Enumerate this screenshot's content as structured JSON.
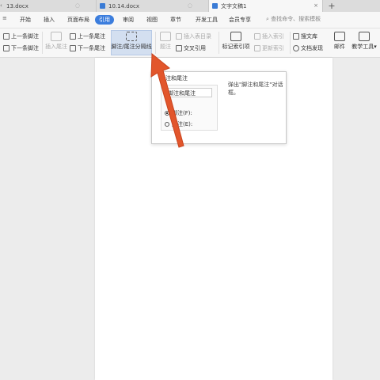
{
  "tabs": [
    {
      "label": "13.docx"
    },
    {
      "label": "10.14.docx"
    },
    {
      "label": "文字文稿1"
    }
  ],
  "menu": {
    "items": [
      "开始",
      "插入",
      "页面布局",
      "引用",
      "审阅",
      "视图",
      "章节",
      "开发工具",
      "会员专享"
    ],
    "active": "引用",
    "search_placeholder": "查找命令、搜索模板"
  },
  "ribbon": {
    "prev_footnote": "上一条脚注",
    "next_footnote": "下一条脚注",
    "insert_endnote": "插入尾注",
    "prev_endnote": "上一条尾注",
    "next_endnote": "下一条尾注",
    "separator_btn": "脚注/尾注分隔线",
    "caption": "题注",
    "insert_toc": "插入表目录",
    "cross_ref": "交叉引用",
    "mark_index": "标记索引项",
    "insert_index": "插入索引",
    "update_index": "更新索引",
    "doc_library": "搜文库",
    "doc_discover": "文档发现",
    "mail": "邮件",
    "tools": "教学工具"
  },
  "tooltip": {
    "title": "脚注和尾注",
    "field": "脚注和尾注",
    "opt_footnote": "脚注(F):",
    "opt_endnote": "尾注(E):",
    "description": "弹出\"脚注和尾注\"对话框。"
  },
  "colors": {
    "accent": "#3b7ddd",
    "arrow": "#e2562c",
    "highlight": "#d3dff0"
  }
}
